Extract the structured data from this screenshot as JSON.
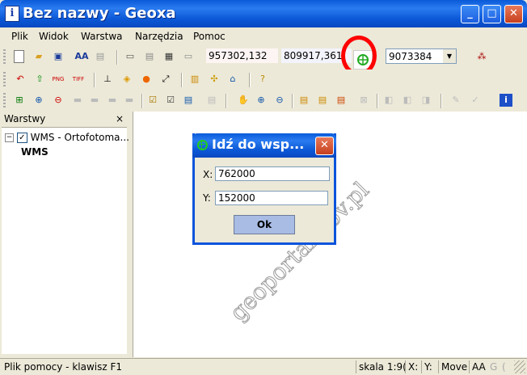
{
  "window": {
    "title": "Bez nazwy - Geoxa"
  },
  "menu": {
    "items": [
      {
        "label": "Plik"
      },
      {
        "label": "Widok"
      },
      {
        "label": "Warstwa"
      },
      {
        "label": "Narzędzia"
      },
      {
        "label": "Pomoc"
      }
    ]
  },
  "toolbar": {
    "coord_x": "957302,132",
    "coord_y": "809917,361",
    "scale": "9073384",
    "text_tool": "AA"
  },
  "layers": {
    "title": "Warstwy",
    "close": "×",
    "tree_toggle": "−",
    "check": "✓",
    "item": "WMS - Ortofotoma...",
    "sub": "WMS"
  },
  "dialog": {
    "title": "Idź do wsp...",
    "x_label": "X:",
    "x_value": "762000",
    "y_label": "Y:",
    "y_value": "152000",
    "ok_label": "Ok"
  },
  "watermark": "geoportal.gov.pl",
  "status": {
    "help": "Plik pomocy - klawisz F1",
    "scale": "skala 1:9(",
    "x": "X:",
    "y": "Y:",
    "move": "Move",
    "aa": "AA",
    "g": "G",
    "c": "("
  },
  "colors": {
    "accent": "#0a54dc",
    "highlight": "#ff0000",
    "title_text": "#ffffff"
  }
}
